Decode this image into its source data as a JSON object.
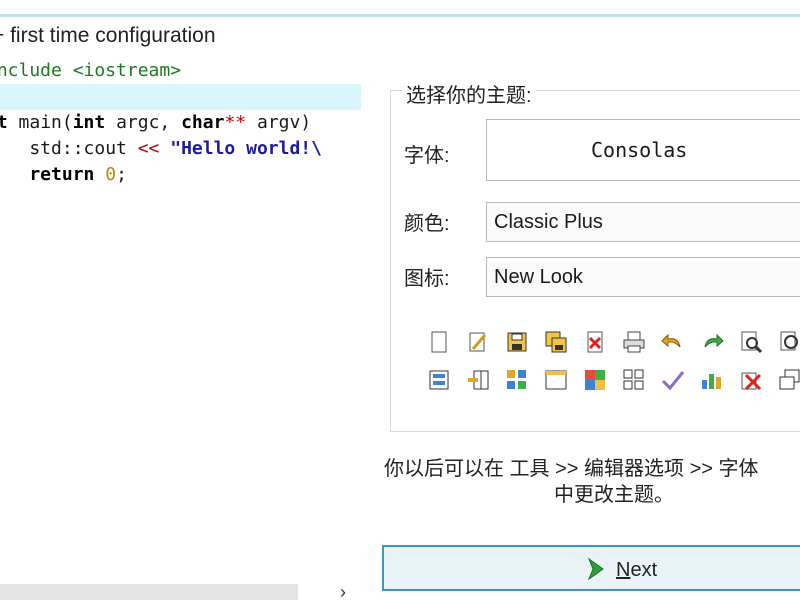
{
  "title": "+ first time configuration",
  "code": {
    "line1": "include <iostream>",
    "line3_kw1": "nt",
    "line3_fn": " main(",
    "line3_kw2": "int",
    "line3_p1": " argc, ",
    "line3_kw3": "char",
    "line3_op": "**",
    "line3_p2": " argv)",
    "line4_a": "    std::cout ",
    "line4_op": "<<",
    "line4_str": " \"Hello world!\\",
    "line5_kw": "    return ",
    "line5_num": "0",
    "line5_end": ";"
  },
  "panel": {
    "title": "选择你的主题:",
    "font_label": "字体:",
    "font_value": "Consolas",
    "color_label": "颜色:",
    "color_value": "Classic Plus",
    "icon_label": "图标:",
    "icon_value": "New Look",
    "icons_row1": [
      "new-file-icon",
      "edit-file-icon",
      "save-icon",
      "save-all-icon",
      "close-file-icon",
      "print-icon",
      "undo-icon",
      "redo-icon",
      "find-icon",
      "find-next-icon"
    ],
    "icons_row2": [
      "layout-icon",
      "split-left-icon",
      "grid-color-icon",
      "window-icon",
      "windows-icon",
      "grid-icon",
      "check-icon",
      "chart-icon",
      "close-all-icon",
      "restore-icon"
    ]
  },
  "hint": {
    "line1": "你以后可以在 工具 >> 编辑器选项 >> 字体",
    "line2": "中更改主题。"
  },
  "next_button": {
    "mnemonic": "N",
    "rest": "ext"
  },
  "scroll_chevron": "›"
}
